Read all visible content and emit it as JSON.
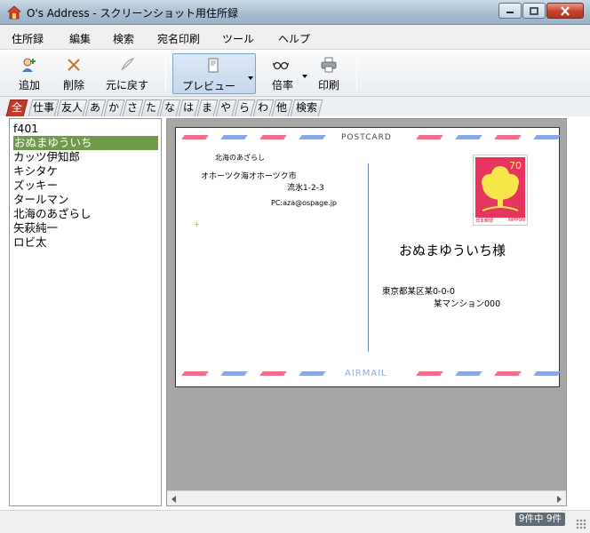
{
  "window": {
    "title": "O's Address - スクリーンショット用住所録",
    "app_icon": "house-icon",
    "buttons": {
      "minimize": "minimize-icon",
      "maximize": "maximize-icon",
      "close": "close-icon"
    }
  },
  "menu": {
    "items": [
      "住所録",
      "編集",
      "検索",
      "宛名印刷",
      "ツール",
      "ヘルプ"
    ]
  },
  "toolbar": {
    "add": "追加",
    "delete": "削除",
    "undo": "元に戻す",
    "preview": "プレビュー",
    "zoom": "倍率",
    "print": "印刷"
  },
  "tabs": {
    "items": [
      "全",
      "仕事",
      "友人",
      "あ",
      "か",
      "さ",
      "た",
      "な",
      "は",
      "ま",
      "や",
      "ら",
      "わ",
      "他",
      "検索"
    ],
    "active": "全"
  },
  "list": {
    "items": [
      "f401",
      "おぬまゆういち",
      "カッツ伊知郎",
      "キシタケ",
      "ズッキー",
      "タールマン",
      "北海のあざらし",
      "矢萩純一",
      "ロビ太"
    ],
    "selected_index": 1
  },
  "postcard": {
    "header": "POSTCARD",
    "footer": "AIRMAIL",
    "sender_name": "北海のあざらし",
    "sender_address_1": "オホーツク海オホーツク市",
    "sender_address_2": "流氷1-2-3",
    "sender_email": "PC:aza@ospage.jp",
    "stamp_value": "70",
    "stamp_label_left": "日本郵便",
    "stamp_label_right": "NIPPON",
    "recipient_name": "おぬまゆういち様",
    "recipient_address_1": "東京都某区某0-0-0",
    "recipient_address_2": "某マンション000",
    "colors": {
      "red": "#f0708a",
      "blue": "#8aa8e6",
      "stamp": "#e8355f",
      "tree": "#f6e84a"
    }
  },
  "status": {
    "count": "9件中 9件"
  }
}
